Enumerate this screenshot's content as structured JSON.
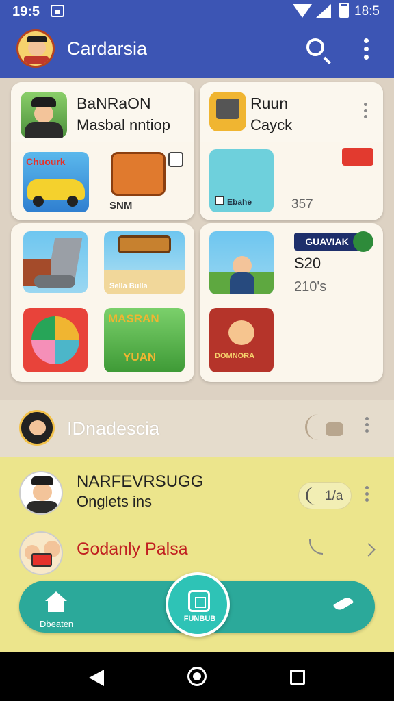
{
  "status_bar": {
    "time": "19:5",
    "time_right": "18:5"
  },
  "app_bar": {
    "title": "Cardarsia"
  },
  "card1": {
    "line1": "BaNRaON",
    "line2": "Masbal nntiop",
    "tile_texts": [
      "Chuourk",
      "SNM"
    ]
  },
  "card2": {
    "line1": "Ruun",
    "line2": "Cayck",
    "teal_label": "Ebahe",
    "count": "357"
  },
  "card3": {
    "tile_texts": [
      "Sella Bulla",
      "MASRAN",
      "YUAN"
    ]
  },
  "card4": {
    "badge": "GUAVIAK",
    "value1": "S20",
    "value2": "210's",
    "tile_text": "DOMNORA"
  },
  "mid_row": {
    "label": "IDnadescia"
  },
  "list": [
    {
      "title": "NARFEVRSUGG",
      "subtitle": "Onglets ins",
      "pill_value": "1/a"
    },
    {
      "title": "Godanly Palsa"
    }
  ],
  "bottom_nav": {
    "home_label": "Dbeaten",
    "fab_label": "FUNBUB"
  },
  "colors": {
    "primary": "#3c55b4",
    "accent": "#2ba99a",
    "list_bg": "#ece58c"
  }
}
